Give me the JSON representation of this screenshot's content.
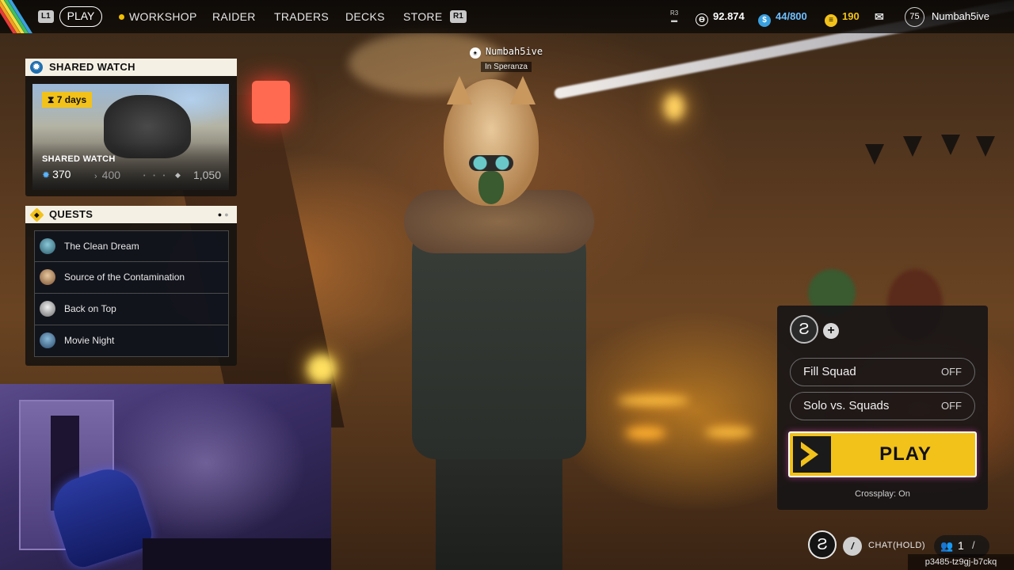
{
  "topbar": {
    "left_shoulder": "L1",
    "right_shoulder": "R1",
    "tabs": [
      {
        "label": "PLAY",
        "active": true
      },
      {
        "label": "WORKSHOP",
        "active": false
      },
      {
        "label": "RAIDER",
        "active": false
      },
      {
        "label": "TRADERS",
        "active": false
      },
      {
        "label": "DECKS",
        "active": false
      },
      {
        "label": "STORE",
        "active": false
      }
    ],
    "r3_label": "R3",
    "currency_coins": "92.874",
    "currency_tokens": "44/800",
    "currency_raider": "190",
    "level": "75",
    "username": "Numbah5ive"
  },
  "player_tag": {
    "name": "Numbah5ive",
    "location": "In Speranza"
  },
  "shared_watch": {
    "title": "SHARED WATCH",
    "timer": "7 days",
    "card_title": "SHARED WATCH",
    "current": "370",
    "next": "400",
    "max": "1,050"
  },
  "quests": {
    "title": "QUESTS",
    "items": [
      {
        "label": "The Clean Dream",
        "avatar_color": "#3a7a8a"
      },
      {
        "label": "Source of the Contamination",
        "avatar_color": "#c8a070"
      },
      {
        "label": "Back on Top",
        "avatar_color": "#d8d8d8"
      },
      {
        "label": "Movie Night",
        "avatar_color": "#4a7a9a"
      }
    ]
  },
  "squad": {
    "fill_squad_label": "Fill Squad",
    "fill_squad_value": "OFF",
    "solo_label": "Solo vs. Squads",
    "solo_value": "OFF",
    "play_label": "PLAY",
    "crossplay": "Crossplay: On"
  },
  "hud": {
    "chat_label": "CHAT(HOLD)",
    "friends_count": "1",
    "session_id": "p3485-tz9gj-b7ckq"
  },
  "colors": {
    "accent_yellow": "#f2c21a",
    "shared_watch_blue": "#1e6fb0"
  }
}
